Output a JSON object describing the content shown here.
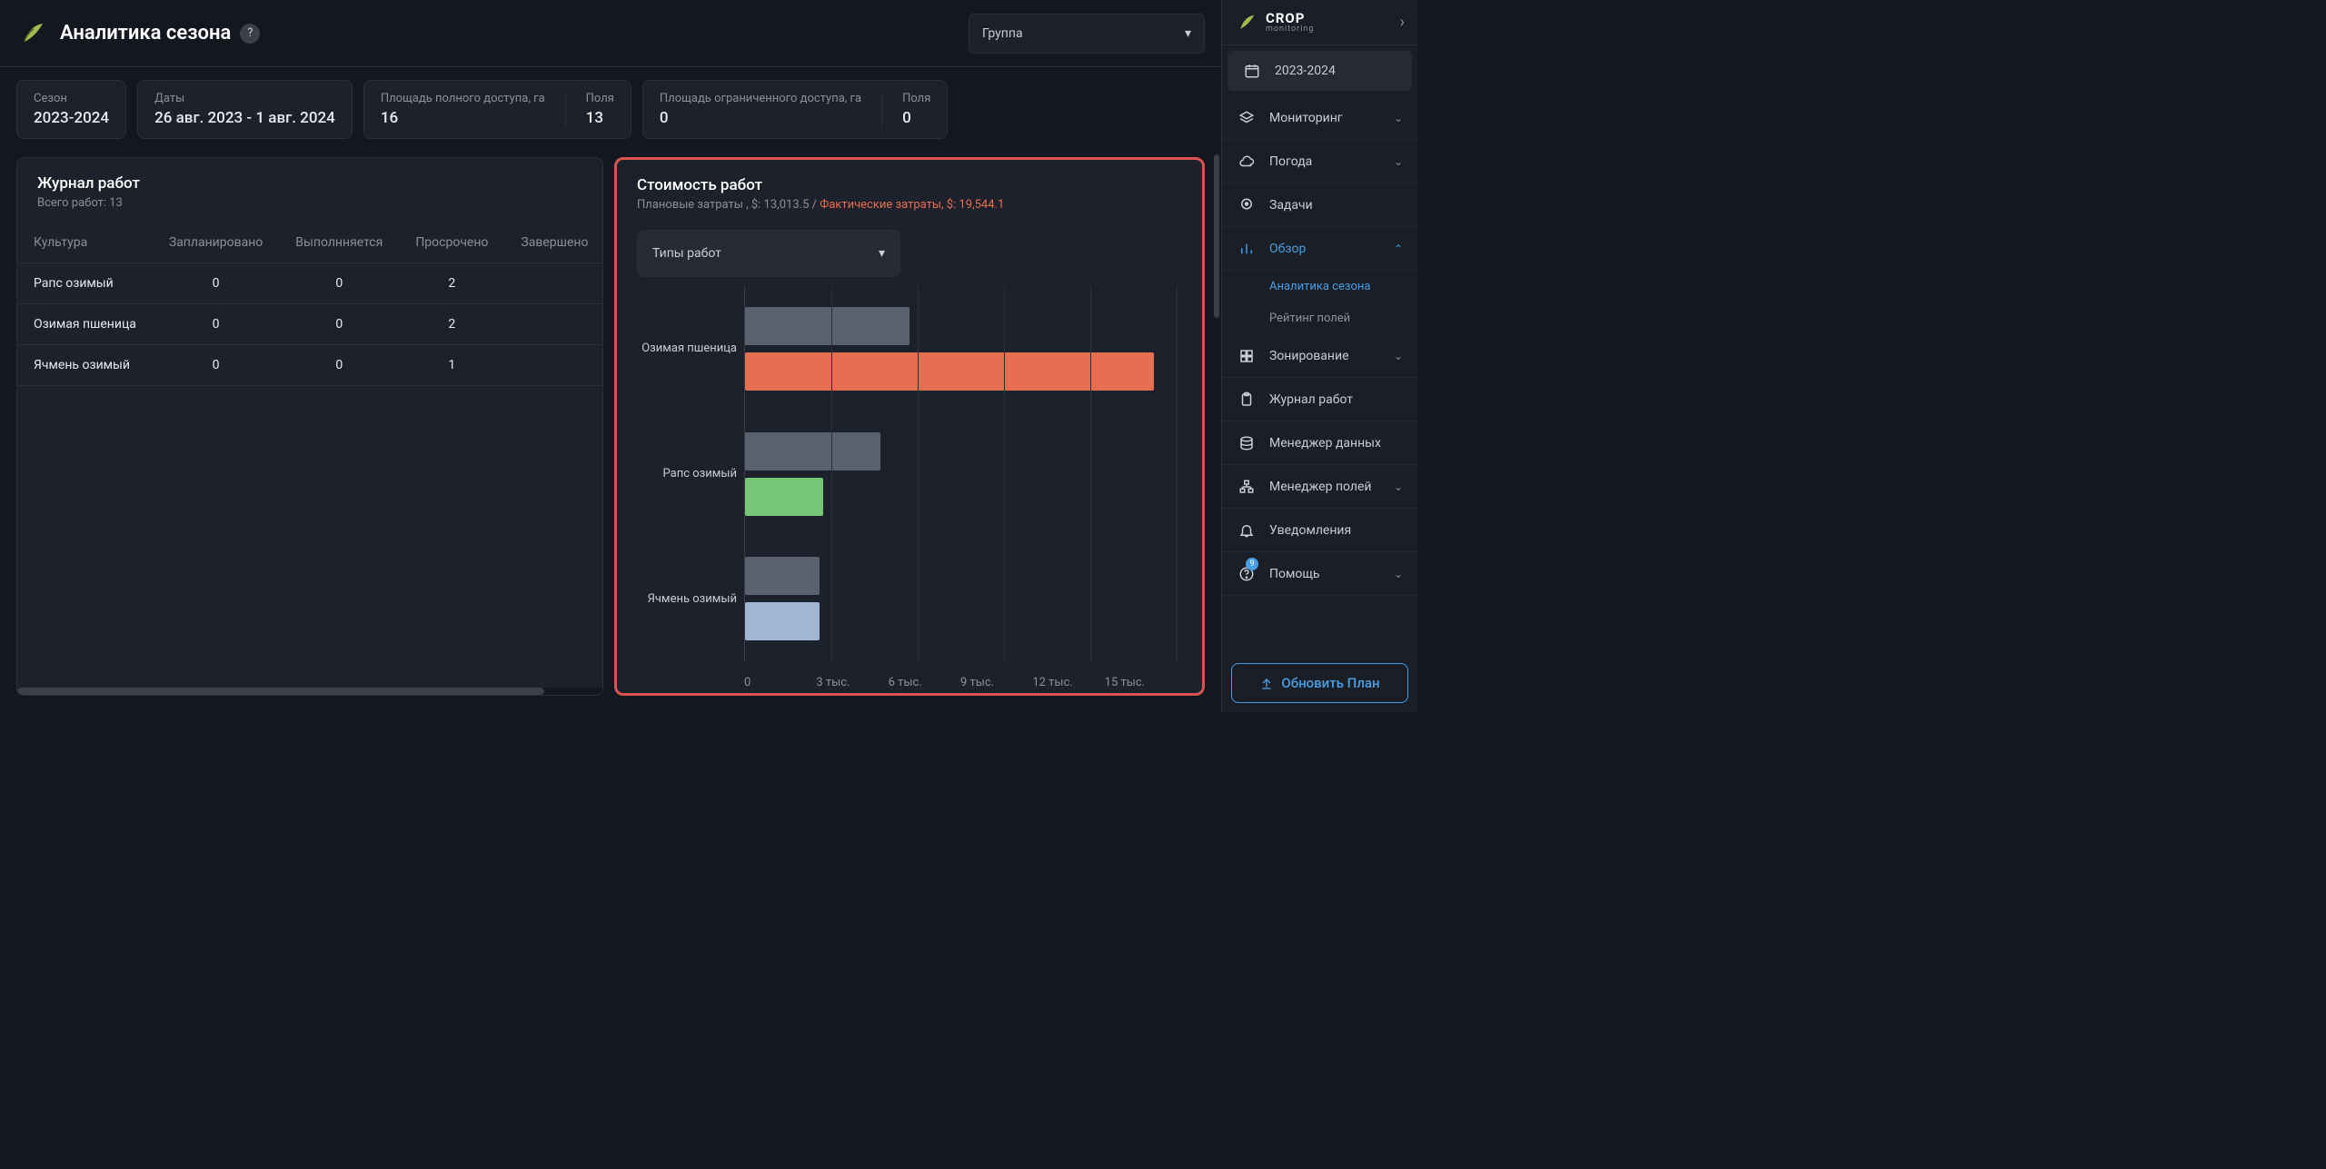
{
  "header": {
    "title": "Аналитика сезона",
    "help": "?",
    "group_label": "Группа"
  },
  "stats": {
    "season": {
      "label": "Сезон",
      "value": "2023-2024"
    },
    "dates": {
      "label": "Даты",
      "value": "26 авг. 2023 - 1 авг. 2024"
    },
    "full_area": {
      "label": "Площадь полного доступа, га",
      "value": "16"
    },
    "full_fields": {
      "label": "Поля",
      "value": "13"
    },
    "limited_area": {
      "label": "Площадь ограниченного доступа, га",
      "value": "0"
    },
    "limited_fields": {
      "label": "Поля",
      "value": "0"
    }
  },
  "journal": {
    "title": "Журнал работ",
    "subtitle": "Всего работ: 13",
    "columns": [
      "Культура",
      "Запланировано",
      "Выполнняется",
      "Просрочено",
      "Завершено"
    ],
    "rows": [
      {
        "crop": "Рапс озимый",
        "planned": "0",
        "running": "0",
        "overdue": "2",
        "done": ""
      },
      {
        "crop": "Озимая пшеница",
        "planned": "0",
        "running": "0",
        "overdue": "2",
        "done": ""
      },
      {
        "crop": "Ячмень озимый",
        "planned": "0",
        "running": "0",
        "overdue": "1",
        "done": ""
      }
    ]
  },
  "cost": {
    "title": "Стоимость работ",
    "planned_label": "Плановые затраты , $: ",
    "planned_value": "13,013.5",
    "sep": " / ",
    "actual_label": "Фактические затраты, $: ",
    "actual_value": "19,544.1",
    "select_label": "Типы работ"
  },
  "chart_data": {
    "type": "bar",
    "orientation": "horizontal",
    "categories": [
      "Озимая пшеница",
      "Рапс озимый",
      "Ячмень озимый"
    ],
    "series": [
      {
        "name": "Плановые затраты",
        "values": [
          5700,
          4700,
          2600
        ],
        "color": "#5a6270"
      },
      {
        "name": "Фактические затраты",
        "values": [
          14200,
          2700,
          2600
        ],
        "colors": [
          "#e76f51",
          "#76c878",
          "#9fb7d3"
        ]
      }
    ],
    "x_ticks": [
      "0",
      "3 тыс.",
      "6 тыс.",
      "9 тыс.",
      "12 тыс.",
      "15 тыс."
    ],
    "x_max": 15000,
    "xlabel": "",
    "ylabel": ""
  },
  "sidebar": {
    "brand_top": "CROP",
    "brand_bot": "monitoring",
    "season": "2023-2024",
    "items": {
      "monitoring": "Мониторинг",
      "weather": "Погода",
      "tasks": "Задачи",
      "overview": "Обзор",
      "analytics": "Аналитика сезона",
      "rating": "Рейтинг полей",
      "zoning": "Зонирование",
      "journal": "Журнал работ",
      "data_mgr": "Менеджер данных",
      "field_mgr": "Менеджер полей",
      "notifications": "Уведомления",
      "help": "Помощь",
      "help_badge": "9"
    },
    "update_btn": "Обновить План"
  }
}
